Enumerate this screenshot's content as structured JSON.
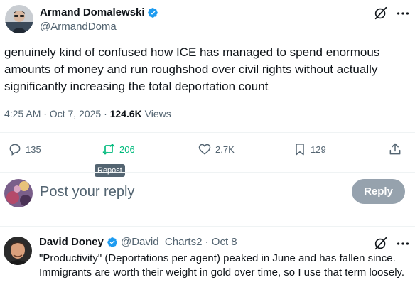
{
  "post": {
    "author": {
      "name": "Armand Domalewski",
      "handle": "@ArmandDoma"
    },
    "text": "genuinely kind of confused how ICE has managed to spend enormous amounts of money and run roughshod over civil rights without actually significantly increasing the total deportation count",
    "time": "4:25 AM · Oct 7, 2025 · ",
    "views_count": "124.6K",
    "views_label": " Views",
    "stats": {
      "replies": "135",
      "reposts": "206",
      "likes": "2.7K",
      "bookmarks": "129"
    },
    "tooltip": "Repost"
  },
  "composer": {
    "placeholder": "Post your reply",
    "button_label": "Reply"
  },
  "reply": {
    "author": {
      "name": "David Doney",
      "handle": "@David_Charts2 · Oct 8"
    },
    "text": "\"Productivity\" (Deportations per agent) peaked in June and has fallen since. Immigrants are worth their weight in gold over time, so I use that term loosely."
  },
  "colors": {
    "accent_blue": "#1d9bf0",
    "repost_green": "#00ba7c",
    "muted": "#536471",
    "button_disabled": "#8b98a5"
  },
  "icons": [
    "grok-icon",
    "more-icon",
    "reply-icon",
    "repost-icon",
    "like-icon",
    "bookmark-icon",
    "share-icon",
    "verified-badge-icon"
  ]
}
